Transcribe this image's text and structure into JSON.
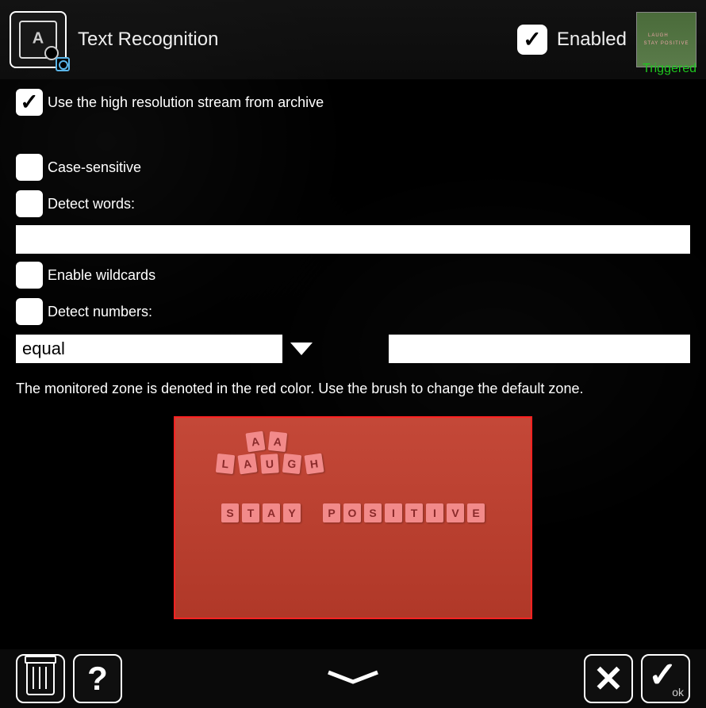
{
  "header": {
    "title": "Text Recognition",
    "enabled_label": "Enabled",
    "enabled_checked": true,
    "triggered_label": "Triggered"
  },
  "options": {
    "use_high_res": {
      "label": "Use the high resolution stream from archive",
      "checked": true
    },
    "case_sensitive": {
      "label": "Case-sensitive",
      "checked": false
    },
    "detect_words": {
      "label": "Detect words:",
      "checked": false,
      "value": ""
    },
    "enable_wildcards": {
      "label": "Enable wildcards",
      "checked": false
    },
    "detect_numbers": {
      "label": "Detect numbers:",
      "checked": false,
      "comparator": "equal",
      "value": ""
    }
  },
  "zone_hint": "The monitored zone is denoted in the red color. Use the brush to change the default zone.",
  "preview_tiles": {
    "row1": [
      "A",
      "A"
    ],
    "row2": [
      "L",
      "A",
      "U",
      "G",
      "H"
    ],
    "row3a": [
      "S",
      "T",
      "A",
      "Y"
    ],
    "row3b": [
      "P",
      "O",
      "S",
      "I",
      "T",
      "I",
      "V",
      "E"
    ]
  },
  "footer": {
    "ok_label": "ok"
  }
}
